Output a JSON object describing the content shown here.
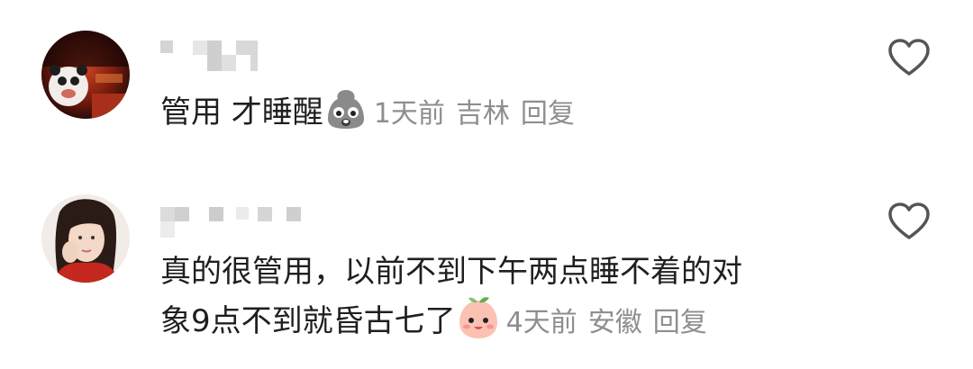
{
  "comments": [
    {
      "text": "管用 才睡醒",
      "emoji": "grimacing-ghost-emoji",
      "time": "1天前",
      "location": "吉林",
      "reply": "回复"
    },
    {
      "text": "真的很管用，以前不到下午两点睡不着的对象9点不到就昏古七了",
      "line1": "真的很管用，以前不到下午两点睡不着的对",
      "line2": "象9点不到就昏古七了",
      "emoji": "peach-smile-emoji",
      "time": "4天前",
      "location": "安徽",
      "reply": "回复"
    }
  ],
  "icons": {
    "like": "heart-outline-icon"
  },
  "colors": {
    "text": "#1f1f1f",
    "meta": "#8e8e8e",
    "icon": "#555555"
  }
}
